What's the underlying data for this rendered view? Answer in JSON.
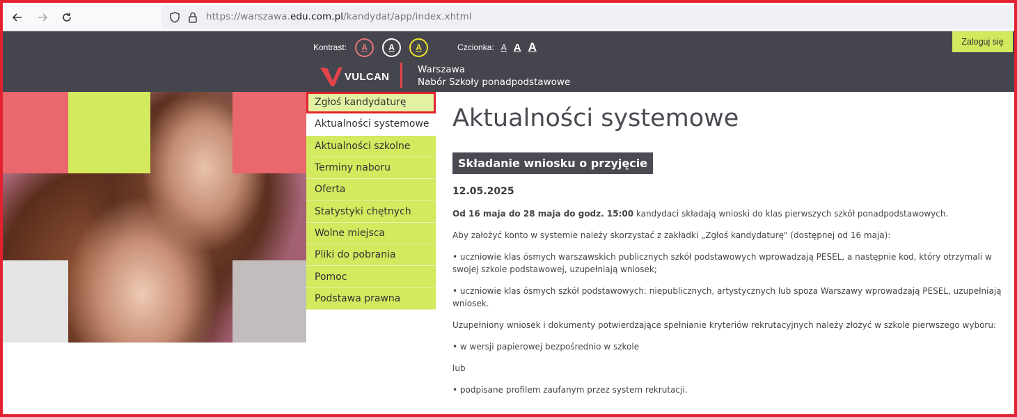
{
  "browser": {
    "url_prefix": "https://warszawa.",
    "url_host": "edu.com.pl",
    "url_path": "/kandydat/app/index.xhtml"
  },
  "header": {
    "contrast_label": "Kontrast:",
    "contrast_options": [
      "A",
      "A",
      "A"
    ],
    "font_label": "Czcionka:",
    "font_options": [
      "A",
      "A",
      "A"
    ],
    "login_label": "Zaloguj się",
    "logo_text": "VULCAN",
    "city": "Warszawa",
    "system_name": "Nabór Szkoły ponadpodstawowe",
    "colors": {
      "accent_lime": "#d3e95e",
      "accent_red": "#e9676d",
      "header_bg": "#45454e"
    }
  },
  "menu": {
    "items": [
      {
        "label": "Zgłoś kandydaturę"
      },
      {
        "label": "Aktualności systemowe"
      },
      {
        "label": "Aktualności szkolne"
      },
      {
        "label": "Terminy naboru"
      },
      {
        "label": "Oferta"
      },
      {
        "label": "Statystyki chętnych"
      },
      {
        "label": "Wolne miejsca"
      },
      {
        "label": "Pliki do pobrania"
      },
      {
        "label": "Pomoc"
      },
      {
        "label": "Podstawa prawna"
      }
    ]
  },
  "main": {
    "title": "Aktualności systemowe",
    "news_heading": "Składanie wniosku o przyjęcie",
    "news_date": "12.05.2025",
    "p1_bold": "Od 16 maja do 28 maja do godz. 15:00",
    "p1_rest": " kandydaci składają wnioski do klas pierwszych szkół ponadpodstawowych.",
    "p2": "Aby założyć konto w systemie należy skorzystać z zakładki „Zgłoś kandydaturę\" (dostępnej od 16 maja):",
    "p3": "• uczniowie klas ósmych warszawskich publicznych szkół podstawowych wprowadzają PESEL, a następnie kod, który otrzymali w swojej szkole podstawowej, uzupełniają wniosek;",
    "p4": "• uczniowie klas ósmych szkół podstawowych: niepublicznych, artystycznych lub spoza Warszawy wprowadzają PESEL, uzupełniają wniosek.",
    "p5": "Uzupełniony wniosek i dokumenty potwierdzające spełnianie kryteriów rekrutacyjnych należy złożyć w szkole pierwszego wyboru:",
    "p6": "• w wersji papierowej bezpośrednio w szkole",
    "p7": "lub",
    "p8": "• podpisane profilem zaufanym przez system rekrutacji."
  }
}
